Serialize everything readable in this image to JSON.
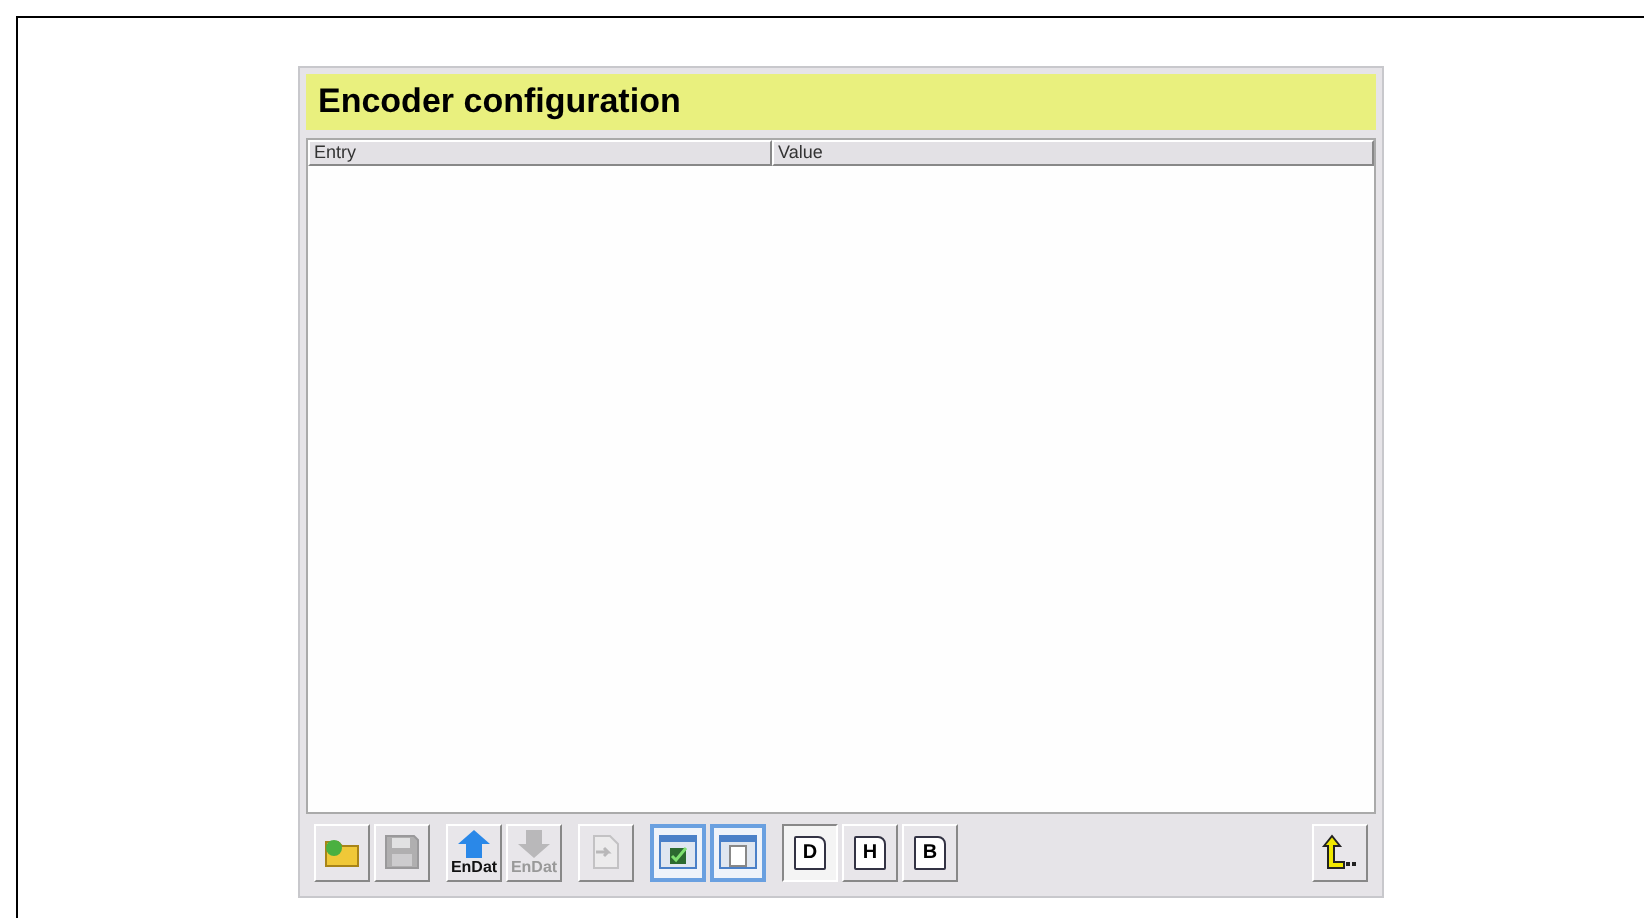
{
  "window": {
    "title": "Encoder configuration"
  },
  "table": {
    "columns": [
      "Entry",
      "Value"
    ]
  },
  "toolbar": {
    "groups": [
      [
        {
          "kind": "folder",
          "disabled": false,
          "selected": false
        },
        {
          "kind": "save",
          "disabled": true,
          "selected": false
        }
      ],
      [
        {
          "kind": "upload",
          "label": "EnDat",
          "disabled": false,
          "selected": false
        },
        {
          "kind": "download",
          "label": "EnDat",
          "disabled": true,
          "selected": false
        }
      ],
      [
        {
          "kind": "import",
          "disabled": true,
          "selected": false
        }
      ],
      [
        {
          "kind": "check-window",
          "disabled": false,
          "selected": true
        },
        {
          "kind": "doc-window",
          "disabled": false,
          "selected": true
        }
      ],
      [
        {
          "kind": "letter",
          "label": "D",
          "disabled": false,
          "selected": true
        },
        {
          "kind": "letter",
          "label": "H",
          "disabled": false,
          "selected": false
        },
        {
          "kind": "letter",
          "label": "B",
          "disabled": false,
          "selected": false
        }
      ]
    ],
    "back": {
      "kind": "back"
    }
  }
}
